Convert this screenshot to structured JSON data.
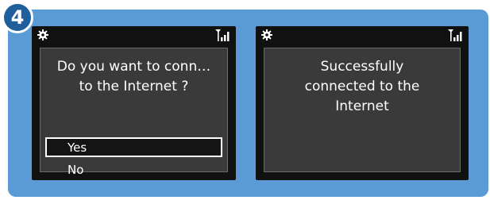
{
  "step": {
    "number": "4"
  },
  "colors": {
    "panel_bg": "#5b9bd5",
    "badge_bg": "#1e5f9c",
    "screen_bg": "#111111",
    "content_bg": "#3a3a3a",
    "text": "#ffffff"
  },
  "left_screen": {
    "status_icons": [
      "gear-icon",
      "signal-icon"
    ],
    "question_line1": "Do you want to conn…",
    "question_line2": "to the Internet ?",
    "options": [
      {
        "label": "Yes",
        "selected": true
      },
      {
        "label": "No",
        "selected": false
      }
    ]
  },
  "right_screen": {
    "status_icons": [
      "gear-icon",
      "signal-icon"
    ],
    "message_lines": [
      "Successfully",
      "connected to the",
      "Internet"
    ]
  }
}
